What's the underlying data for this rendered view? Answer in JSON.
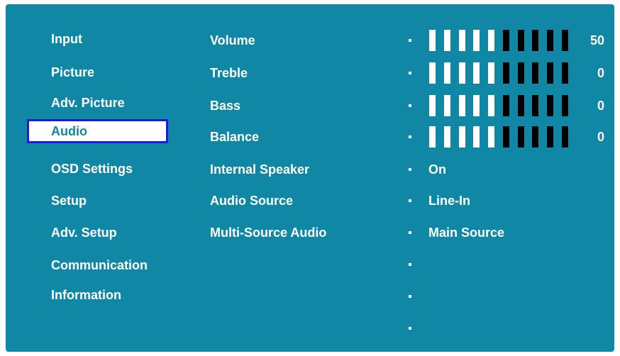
{
  "menu": {
    "items": [
      {
        "label": "Input",
        "selected": false
      },
      {
        "label": "Picture",
        "selected": false
      },
      {
        "label": "Adv. Picture",
        "selected": false
      },
      {
        "label": "Audio",
        "selected": true
      },
      {
        "label": "OSD Settings",
        "selected": false
      },
      {
        "label": "Setup",
        "selected": false
      },
      {
        "label": "Adv. Setup",
        "selected": false
      },
      {
        "label": "Communication",
        "selected": false
      },
      {
        "label": "Information",
        "selected": false
      }
    ]
  },
  "audio": {
    "volume": {
      "label": "Volume",
      "value": "50",
      "level": 0.5
    },
    "treble": {
      "label": "Treble",
      "value": "0",
      "level": 0.5
    },
    "bass": {
      "label": "Bass",
      "value": "0",
      "level": 0.5
    },
    "balance": {
      "label": "Balance",
      "value": "0",
      "level": 0.5
    },
    "internal_speaker": {
      "label": "Internal Speaker",
      "value": "On"
    },
    "audio_source": {
      "label": "Audio Source",
      "value": "Line-In"
    },
    "multi_source_audio": {
      "label": "Multi-Source Audio",
      "value": "Main Source"
    }
  },
  "colors": {
    "background": "#0f87a5",
    "selection_border": "#1a1ae6",
    "text": "#ffffff",
    "bar_on": "#ffffff",
    "bar_off": "#000000"
  }
}
